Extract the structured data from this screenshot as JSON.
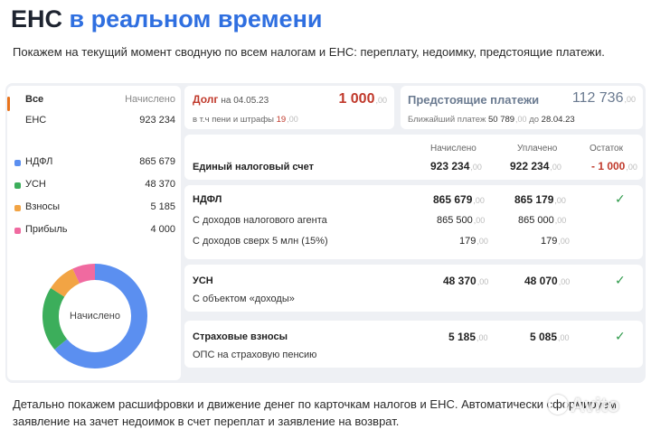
{
  "header": {
    "title_a": "ЕНС",
    "title_b": "в реальном времени",
    "subtitle": "Покажем на текущий момент сводную по всем налогам и ЕНС: переплату, недоимку, предстоящие платежи."
  },
  "sidebar": {
    "head_label": "Все",
    "head_value": "Начислено",
    "ens_label": "ЕНС",
    "ens_value": "923 234",
    "items": [
      {
        "label": "НДФЛ",
        "value": "865 679",
        "color": "#5b8ff0"
      },
      {
        "label": "УСН",
        "value": "48 370",
        "color": "#3cae5b"
      },
      {
        "label": "Взносы",
        "value": "5 185",
        "color": "#f2a444"
      },
      {
        "label": "Прибыль",
        "value": "4 000",
        "color": "#f06aa0"
      }
    ],
    "donut_label": "Начислено"
  },
  "debt": {
    "title": "Долг",
    "date_prefix": "на",
    "date": "04.05.23",
    "amount": "1 000",
    "cents": ",00",
    "sub": "в т.ч пени и штрафы",
    "sub_value": "19",
    "sub_cents": ",00"
  },
  "upcoming": {
    "title": "Предстоящие платежи",
    "amount": "112 736",
    "cents": ",00",
    "sub_prefix": "Ближайший платеж",
    "sub_value": "50 789",
    "sub_cents": ",00",
    "sub_mid": "до",
    "sub_date": "28.04.23"
  },
  "columns": {
    "accrued": "Начислено",
    "paid": "Уплачено",
    "balance": "Остаток"
  },
  "ens": {
    "name": "Единый налоговый счет",
    "accrued": "923 234",
    "paid": "922 234",
    "balance": "- 1 000",
    "cents": ",00"
  },
  "taxes": [
    {
      "name": "НДФЛ",
      "accrued": "865 679",
      "paid": "865 179",
      "lines": [
        {
          "label": "С доходов налогового агента",
          "accrued": "865 500",
          "paid": "865 000"
        },
        {
          "label": "С доходов сверх 5 млн  (15%)",
          "accrued": "179",
          "paid": "179"
        }
      ]
    },
    {
      "name": "УСН",
      "accrued": "48 370",
      "paid": "48 070",
      "lines": [
        {
          "label": "С объектом «доходы»",
          "accrued": "",
          "paid": ""
        }
      ]
    },
    {
      "name": "Страховые взносы",
      "accrued": "5 185",
      "paid": "5 085",
      "lines": [
        {
          "label": "ОПС на страховую пенсию",
          "accrued": "",
          "paid": ""
        }
      ]
    }
  ],
  "check_mark": "✓",
  "cents": ",00",
  "footer": "Детально покажем расшифровки и движение денег по карточкам налогов и ЕНС. Автоматически сформируем заявление на зачет недоимок в счет переплат и заявление на возврат.",
  "watermark": "Avito"
}
